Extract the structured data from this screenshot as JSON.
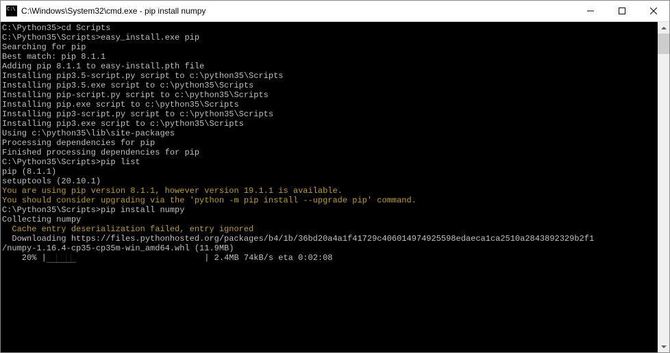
{
  "titlebar": {
    "title": "C:\\Windows\\System32\\cmd.exe - pip  install numpy"
  },
  "terminal": {
    "lines": {
      "l1": "C:\\Python35>cd Scripts",
      "l2": "",
      "l3": "C:\\Python35\\Scripts>easy_install.exe pip",
      "l4": "Searching for pip",
      "l5": "Best match: pip 8.1.1",
      "l6": "Adding pip 8.1.1 to easy-install.pth file",
      "l7": "Installing pip3.5-script.py script to c:\\python35\\Scripts",
      "l8": "Installing pip3.5.exe script to c:\\python35\\Scripts",
      "l9": "Installing pip-script.py script to c:\\python35\\Scripts",
      "l10": "Installing pip.exe script to c:\\python35\\Scripts",
      "l11": "Installing pip3-script.py script to c:\\python35\\Scripts",
      "l12": "Installing pip3.exe script to c:\\python35\\Scripts",
      "l13": "",
      "l14": "Using c:\\python35\\lib\\site-packages",
      "l15": "Processing dependencies for pip",
      "l16": "Finished processing dependencies for pip",
      "l17": "",
      "l18": "C:\\Python35\\Scripts>pip list",
      "l19": "pip (8.1.1)",
      "l20": "setuptools (20.10.1)",
      "l21": "You are using pip version 8.1.1, however version 19.1.1 is available.",
      "l22": "You should consider upgrading via the 'python -m pip install --upgrade pip' command.",
      "l23": "",
      "l24": "C:\\Python35\\Scripts>pip install numpy",
      "l25": "Collecting numpy",
      "l26": "  Cache entry deserialization failed, entry ignored",
      "l27": "  Downloading https://files.pythonhosted.org/packages/b4/1b/36bd20a4a1f41729c406014974925598edaeca1ca2510a2843892329b2f1",
      "l28": "/numpy-1.16.4-cp35-cp35m-win_amd64.whl (11.9MB)",
      "l29_pct": "    20% |",
      "l29_bar": "██████",
      "l29_rest": "                          | 2.4MB 74kB/s eta 0:02:08"
    }
  }
}
